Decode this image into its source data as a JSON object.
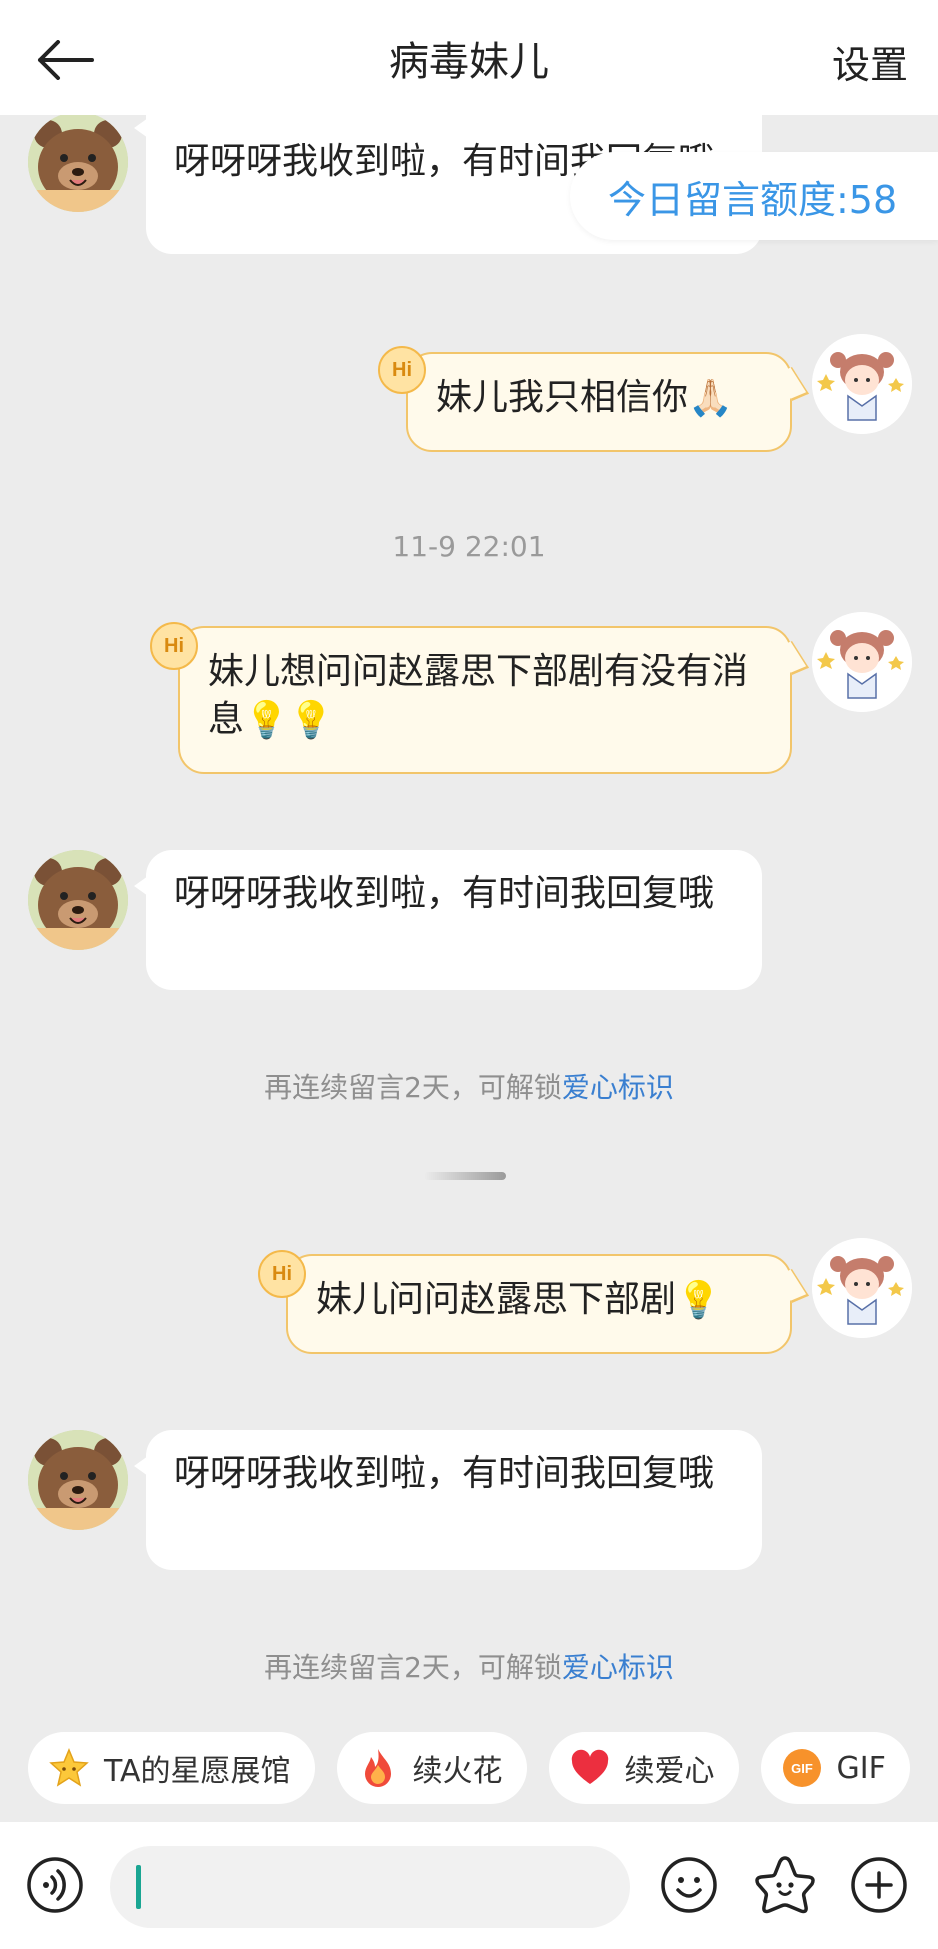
{
  "header": {
    "title": "病毒妹儿",
    "settings_label": "设置"
  },
  "quota": {
    "label": "今日留言额度:58"
  },
  "messages": [
    {
      "side": "left",
      "text": "呀呀呀我收到啦，有时间我回复哦"
    },
    {
      "side": "right",
      "text": "妹儿我只相信你",
      "emoji": "🙏🏻"
    },
    {
      "side": "right",
      "text": "妹儿想问问赵露思下部剧有没有消息",
      "emoji": "💡💡"
    },
    {
      "side": "left",
      "text": "呀呀呀我收到啦，有时间我回复哦"
    },
    {
      "side": "right",
      "text": "妹儿问问赵露思下部剧",
      "emoji": "💡"
    },
    {
      "side": "left",
      "text": "呀呀呀我收到啦，有时间我回复哦"
    }
  ],
  "hi_badge": "Hi",
  "timestamp": "11-9 22:01",
  "system_note": {
    "prefix": "再连续留言2天，可解锁",
    "link": "爱心标识"
  },
  "chips": [
    {
      "icon": "star-icon",
      "label": "TA的星愿展馆"
    },
    {
      "icon": "fire-icon",
      "label": "续火花"
    },
    {
      "icon": "heart-icon",
      "label": "续爱心"
    },
    {
      "icon": "gif-icon",
      "label": "GIF"
    }
  ],
  "input": {
    "value": ""
  },
  "colors": {
    "accent_blue": "#3a96e6",
    "link_blue": "#3a7fd0",
    "bubble_right_bg": "#fffaeb",
    "bubble_right_border": "#f2c56a",
    "caret": "#1aa693"
  }
}
